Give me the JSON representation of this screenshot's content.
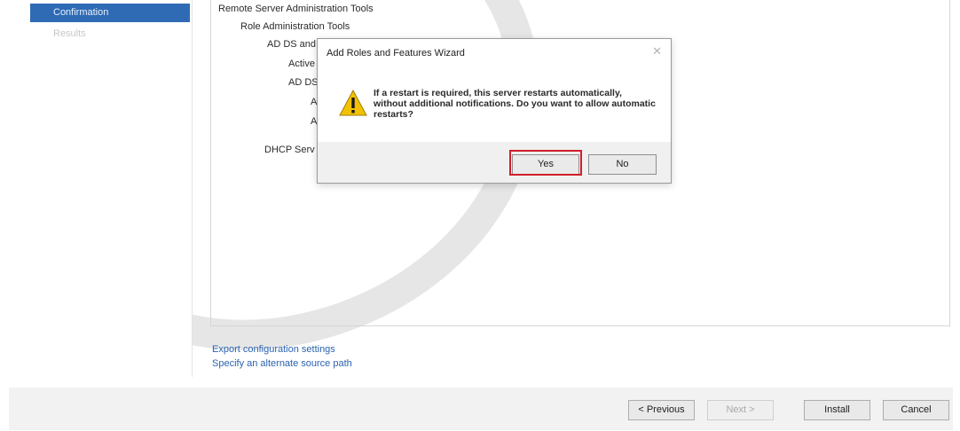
{
  "nav": {
    "items": [
      {
        "label": "Confirmation",
        "state": "active"
      },
      {
        "label": "Results",
        "state": "disabled"
      }
    ]
  },
  "features_tree": [
    {
      "label": "Remote Server Administration Tools",
      "level": 0
    },
    {
      "label": "Role Administration Tools",
      "level": 1
    },
    {
      "label": "AD DS and",
      "level": 2
    },
    {
      "label": "Active",
      "level": 3
    },
    {
      "label": "AD DS",
      "level": 3
    },
    {
      "label": "A",
      "level": 4
    },
    {
      "label": "A",
      "level": 4
    },
    {
      "label": "DHCP Serv",
      "level": 2
    }
  ],
  "links": {
    "export": "Export configuration settings",
    "alternate_source": "Specify an alternate source path"
  },
  "footer": {
    "previous": "< Previous",
    "next": "Next >",
    "install": "Install",
    "cancel": "Cancel"
  },
  "dialog": {
    "title": "Add Roles and Features Wizard",
    "close": "✕",
    "icon": "warning-icon",
    "message": "If a restart is required, this server restarts automatically, without additional notifications. Do you want to allow automatic restarts?",
    "yes": "Yes",
    "no": "No",
    "highlight_color": "#d21e2b"
  },
  "colors": {
    "accent": "#2f6bb5",
    "link": "#2a63b1"
  }
}
